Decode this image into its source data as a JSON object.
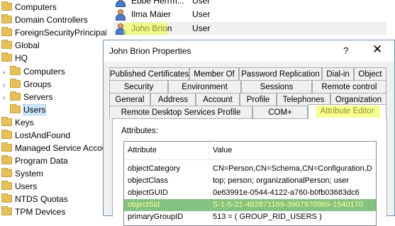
{
  "tree": {
    "items": [
      {
        "label": "Computers"
      },
      {
        "label": "Domain Controllers"
      },
      {
        "label": "ForeignSecurityPrincipal:"
      },
      {
        "label": "Global"
      },
      {
        "label": "HQ"
      },
      {
        "label": "Computers"
      },
      {
        "label": "Groups"
      },
      {
        "label": "Servers"
      },
      {
        "label": "Users"
      },
      {
        "label": "Keys"
      },
      {
        "label": "LostAndFound"
      },
      {
        "label": "Managed Service Accou"
      },
      {
        "label": "Program Data"
      },
      {
        "label": "System"
      },
      {
        "label": "Users"
      },
      {
        "label": "NTDS Quotas"
      },
      {
        "label": "TPM Devices"
      }
    ]
  },
  "user_list": {
    "rows": [
      {
        "name": "Ebbe Herrm...",
        "type": "User"
      },
      {
        "name": "Ilma Maier",
        "type": "User"
      },
      {
        "name": "John Brion",
        "type": "User"
      }
    ]
  },
  "dialog": {
    "title": "John Brion Properties",
    "help_label": "?",
    "close_label": "✕",
    "tabs_row1": [
      "Published Certificates",
      "Member Of",
      "Password Replication",
      "Dial-in",
      "Object"
    ],
    "tabs_row2": [
      "Security",
      "Environment",
      "Sessions",
      "Remote control"
    ],
    "tabs_row3": [
      "General",
      "Address",
      "Account",
      "Profile",
      "Telephones",
      "Organization"
    ],
    "tabs_row4": [
      "Remote Desktop Services Profile",
      "COM+",
      "Attribute Editor"
    ],
    "attributes_label": "Attributes:",
    "columns": [
      "Attribute",
      "Value"
    ],
    "rows": [
      {
        "attribute": "objectCategory",
        "value": "CN=Person,CN=Schema,CN=Configuration,D"
      },
      {
        "attribute": "objectClass",
        "value": "top; person; organizationalPerson; user"
      },
      {
        "attribute": "objectGUID",
        "value": "0e63991e-0544-4122-a760-b0fb03683dc6"
      },
      {
        "attribute": "objectSid",
        "value": "S-1-5-21-482871169-3907970989-1540170"
      },
      {
        "attribute": "primaryGroupID",
        "value": "513 = ( GROUP_RID_USERS )"
      }
    ]
  },
  "colors": {
    "selection": "#0078d7",
    "marker": "#f2ff3c",
    "folder": "#e7c05a"
  }
}
